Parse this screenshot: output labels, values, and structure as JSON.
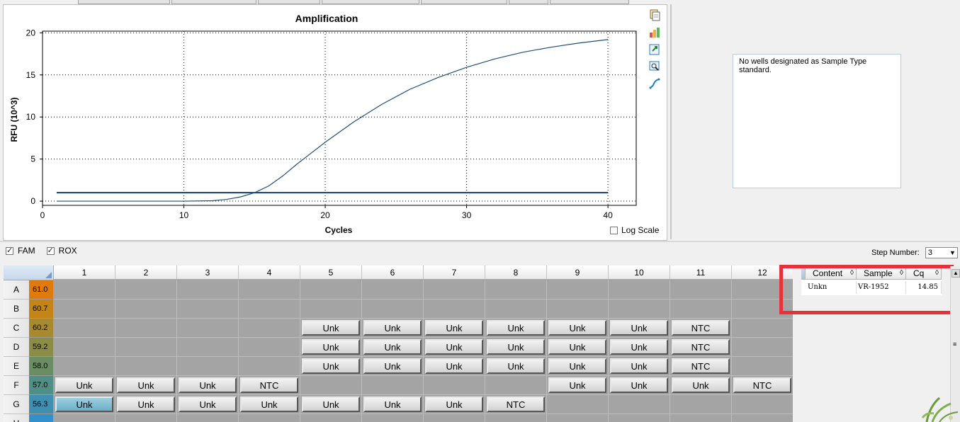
{
  "chart": {
    "title": "Amplification",
    "xlabel": "Cycles",
    "ylabel": "RFU (10^3)",
    "log_scale_label": "Log Scale",
    "log_scale_checked": false,
    "x_ticks": [
      "0",
      "10",
      "20",
      "30",
      "40"
    ],
    "y_ticks": [
      "0",
      "5",
      "10",
      "15",
      "20"
    ]
  },
  "chart_data": {
    "type": "line",
    "title": "Amplification",
    "xlabel": "Cycles",
    "ylabel": "RFU (10^3)",
    "xlim": [
      0,
      42
    ],
    "ylim": [
      -0.5,
      20.2
    ],
    "grid": true,
    "series": [
      {
        "color": "#1f4e79",
        "x": [
          1,
          5,
          10,
          12,
          13,
          14,
          15,
          16,
          17,
          18,
          19,
          20,
          22,
          24,
          26,
          28,
          30,
          32,
          34,
          36,
          38,
          40
        ],
        "y": [
          0.0,
          0.0,
          0.0,
          0.05,
          0.2,
          0.5,
          1.0,
          1.8,
          3.0,
          4.4,
          5.7,
          7.0,
          9.4,
          11.5,
          13.3,
          14.7,
          15.9,
          16.9,
          17.7,
          18.3,
          18.8,
          19.2
        ]
      }
    ],
    "threshold": {
      "y": 1.0,
      "color": "#1a3d63"
    }
  },
  "tool_icons": [
    "copy-icon",
    "chart-settings-icon",
    "export-icon",
    "zoom-icon",
    "curve-icon"
  ],
  "standard_panel": {
    "message": "No wells designated as Sample Type standard."
  },
  "dyes": [
    {
      "label": "FAM",
      "checked": true
    },
    {
      "label": "ROX",
      "checked": true
    }
  ],
  "step": {
    "label": "Step Number:",
    "value": "3"
  },
  "plate": {
    "columns": [
      "1",
      "2",
      "3",
      "4",
      "5",
      "6",
      "7",
      "8",
      "9",
      "10",
      "11",
      "12"
    ],
    "rows": [
      {
        "label": "A",
        "temp": "61.0",
        "color": "#e07a0a",
        "wells": [
          "",
          "",
          "",
          "",
          "",
          "",
          "",
          "",
          "",
          "",
          "",
          ""
        ]
      },
      {
        "label": "B",
        "temp": "60.7",
        "color": "#c58516",
        "wells": [
          "",
          "",
          "",
          "",
          "",
          "",
          "",
          "",
          "",
          "",
          "",
          ""
        ]
      },
      {
        "label": "C",
        "temp": "60.2",
        "color": "#a88a2e",
        "wells": [
          "",
          "",
          "",
          "",
          "Unk",
          "Unk",
          "Unk",
          "Unk",
          "Unk",
          "Unk",
          "NTC",
          ""
        ]
      },
      {
        "label": "D",
        "temp": "59.2",
        "color": "#8b8d47",
        "wells": [
          "",
          "",
          "",
          "",
          "Unk",
          "Unk",
          "Unk",
          "Unk",
          "Unk",
          "Unk",
          "NTC",
          ""
        ]
      },
      {
        "label": "E",
        "temp": "58.0",
        "color": "#6a8d63",
        "wells": [
          "",
          "",
          "",
          "",
          "Unk",
          "Unk",
          "Unk",
          "Unk",
          "Unk",
          "Unk",
          "NTC",
          ""
        ]
      },
      {
        "label": "F",
        "temp": "57.0",
        "color": "#4f8f86",
        "wells": [
          "Unk",
          "Unk",
          "Unk",
          "NTC",
          "",
          "",
          "",
          "",
          "Unk",
          "Unk",
          "Unk",
          "NTC"
        ]
      },
      {
        "label": "G",
        "temp": "56.3",
        "color": "#3f8fb1",
        "wells": [
          "Unk",
          "Unk",
          "Unk",
          "Unk",
          "Unk",
          "Unk",
          "Unk",
          "NTC",
          "",
          "",
          "",
          ""
        ]
      },
      {
        "label": "H",
        "temp": "",
        "color": "#3390cc",
        "wells": [
          "",
          "",
          "",
          "",
          "",
          "",
          "",
          "",
          "",
          "",
          "",
          ""
        ]
      }
    ],
    "selected_well": "G1"
  },
  "results": {
    "headers": [
      "Content",
      "Sample",
      "Cq"
    ],
    "rows": [
      {
        "content": "Unkn",
        "sample": "VR-1952",
        "cq": "14.85"
      }
    ]
  }
}
